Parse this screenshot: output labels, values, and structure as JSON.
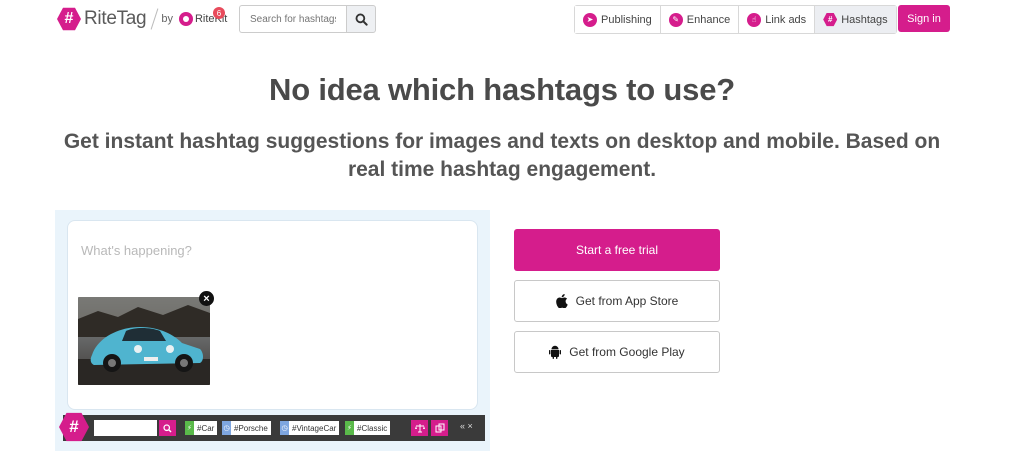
{
  "header": {
    "logo_text": "RiteTag",
    "by_text": "by",
    "ritekit_text": "RiteKit",
    "notification_count": "6",
    "search_placeholder": "Search for hashtags",
    "nav": [
      {
        "label": "Publishing",
        "icon": "send-icon"
      },
      {
        "label": "Enhance",
        "icon": "pencil-icon"
      },
      {
        "label": "Link ads",
        "icon": "hand-pointer-icon"
      },
      {
        "label": "Hashtags",
        "icon": "hashtag-icon"
      }
    ],
    "signin_label": "Sign in"
  },
  "hero": {
    "title": "No idea which hashtags to use?",
    "subtitle": "Get instant hashtag suggestions for images and texts on desktop and mobile. Based on real time hashtag engagement."
  },
  "demo": {
    "composer_placeholder": "What's happening?",
    "tags": [
      {
        "label": "#Car",
        "status": "green"
      },
      {
        "label": "#Porsche",
        "status": "blue"
      },
      {
        "label": "#VintageCar",
        "status": "blue"
      },
      {
        "label": "#Classic",
        "status": "green"
      }
    ],
    "controls": "« ×"
  },
  "cta": {
    "trial_label": "Start a free trial",
    "appstore_label": "Get from App Store",
    "googleplay_label": "Get from Google Play"
  },
  "colors": {
    "brand": "#d51d8c",
    "text": "#4a4a4a",
    "demo_bg": "#eaf4fb",
    "tagbar_bg": "#3a3a3a"
  }
}
